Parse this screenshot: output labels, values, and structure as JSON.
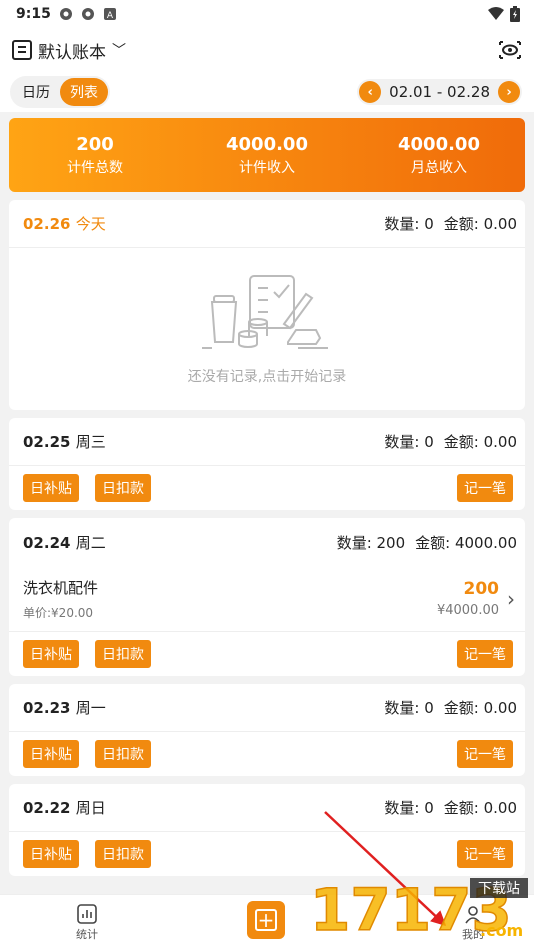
{
  "status": {
    "time": "9:15"
  },
  "topbar": {
    "book_name": "默认账本",
    "book_chevron": "﹀"
  },
  "tabs": {
    "calendar": "日历",
    "list": "列表",
    "date_range": "02.01 - 02.28",
    "prev": "‹",
    "next": "›"
  },
  "summary": [
    {
      "value": "200",
      "label": "计件总数"
    },
    {
      "value": "4000.00",
      "label": "计件收入"
    },
    {
      "value": "4000.00",
      "label": "月总收入"
    }
  ],
  "days": [
    {
      "date": "02.26",
      "weekday": "今天",
      "qty": "数量: 0",
      "amount": "金额: 0.00",
      "empty_text": "还没有记录,点击开始记录"
    },
    {
      "date": "02.25",
      "weekday": "周三",
      "qty": "数量: 0",
      "amount": "金额: 0.00"
    },
    {
      "date": "02.24",
      "weekday": "周二",
      "qty": "数量: 200",
      "amount": "金额: 4000.00",
      "item": {
        "name": "洗衣机配件",
        "unit_price": "单价:¥20.00",
        "count": "200",
        "total": "¥4000.00"
      }
    },
    {
      "date": "02.23",
      "weekday": "周一",
      "qty": "数量: 0",
      "amount": "金额: 0.00"
    },
    {
      "date": "02.22",
      "weekday": "周日",
      "qty": "数量: 0",
      "amount": "金额: 0.00"
    }
  ],
  "actions": {
    "subsidy": "日补贴",
    "deduction": "日扣款",
    "record": "记一笔"
  },
  "nav": {
    "stats": "统计",
    "mine": "我的"
  },
  "colors": {
    "accent": "#f18a0f",
    "gradient_start": "#ffa414",
    "gradient_end": "#f06b0a"
  },
  "watermark": {
    "digits": "17173",
    "sub": "下载站",
    "domain": ".com"
  }
}
